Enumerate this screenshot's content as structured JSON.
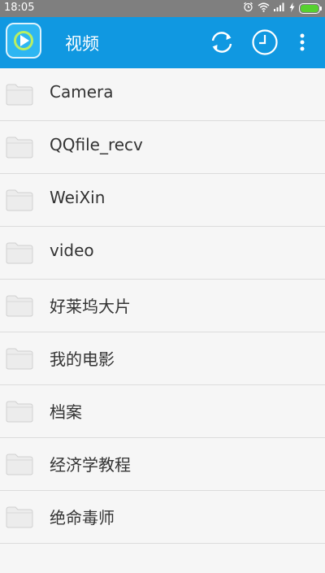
{
  "status": {
    "time": "18:05"
  },
  "appbar": {
    "title": "视频"
  },
  "folders": [
    {
      "label": "Camera"
    },
    {
      "label": "QQfile_recv"
    },
    {
      "label": "WeiXin"
    },
    {
      "label": "video"
    },
    {
      "label": "好莱坞大片"
    },
    {
      "label": "我的电影"
    },
    {
      "label": "档案"
    },
    {
      "label": "经济学教程"
    },
    {
      "label": "绝命毒师"
    }
  ]
}
